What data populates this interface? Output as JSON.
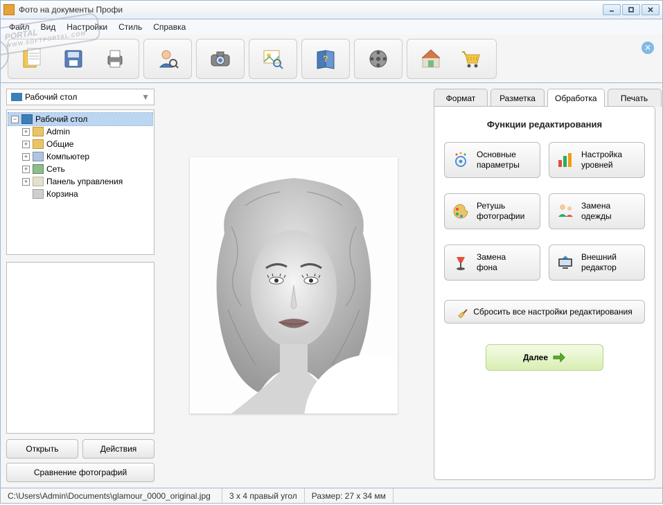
{
  "window": {
    "title": "Фото на документы Профи"
  },
  "menu": {
    "file": "Файл",
    "view": "Вид",
    "settings": "Настройки",
    "style": "Стиль",
    "help": "Справка"
  },
  "location": {
    "label": "Рабочий стол"
  },
  "tree": {
    "root": "Рабочий стол",
    "items": [
      {
        "label": "Admin"
      },
      {
        "label": "Общие"
      },
      {
        "label": "Компьютер"
      },
      {
        "label": "Сеть"
      },
      {
        "label": "Панель управления"
      },
      {
        "label": "Корзина"
      }
    ]
  },
  "left_buttons": {
    "open": "Открыть",
    "actions": "Действия",
    "compare": "Сравнение фотографий"
  },
  "tabs": {
    "format": "Формат",
    "layout": "Разметка",
    "processing": "Обработка",
    "print": "Печать"
  },
  "editing": {
    "heading": "Функции редактирования",
    "basic": "Основные\nпараметры",
    "levels": "Настройка\nуровней",
    "retouch": "Ретушь\nфотографии",
    "clothes": "Замена\nодежды",
    "background": "Замена\nфона",
    "external": "Внешний\nредактор",
    "reset": "Сбросить все настройки редактирования",
    "next": "Далее"
  },
  "status": {
    "path": "C:\\Users\\Admin\\Documents\\glamour_0000_original.jpg",
    "corner": "3 x 4 правый угол",
    "size": "Размер: 27 x 34 мм"
  },
  "watermark": {
    "brand": "PORTAL",
    "sub": "WWW.SOFTPORTAL.COM"
  }
}
